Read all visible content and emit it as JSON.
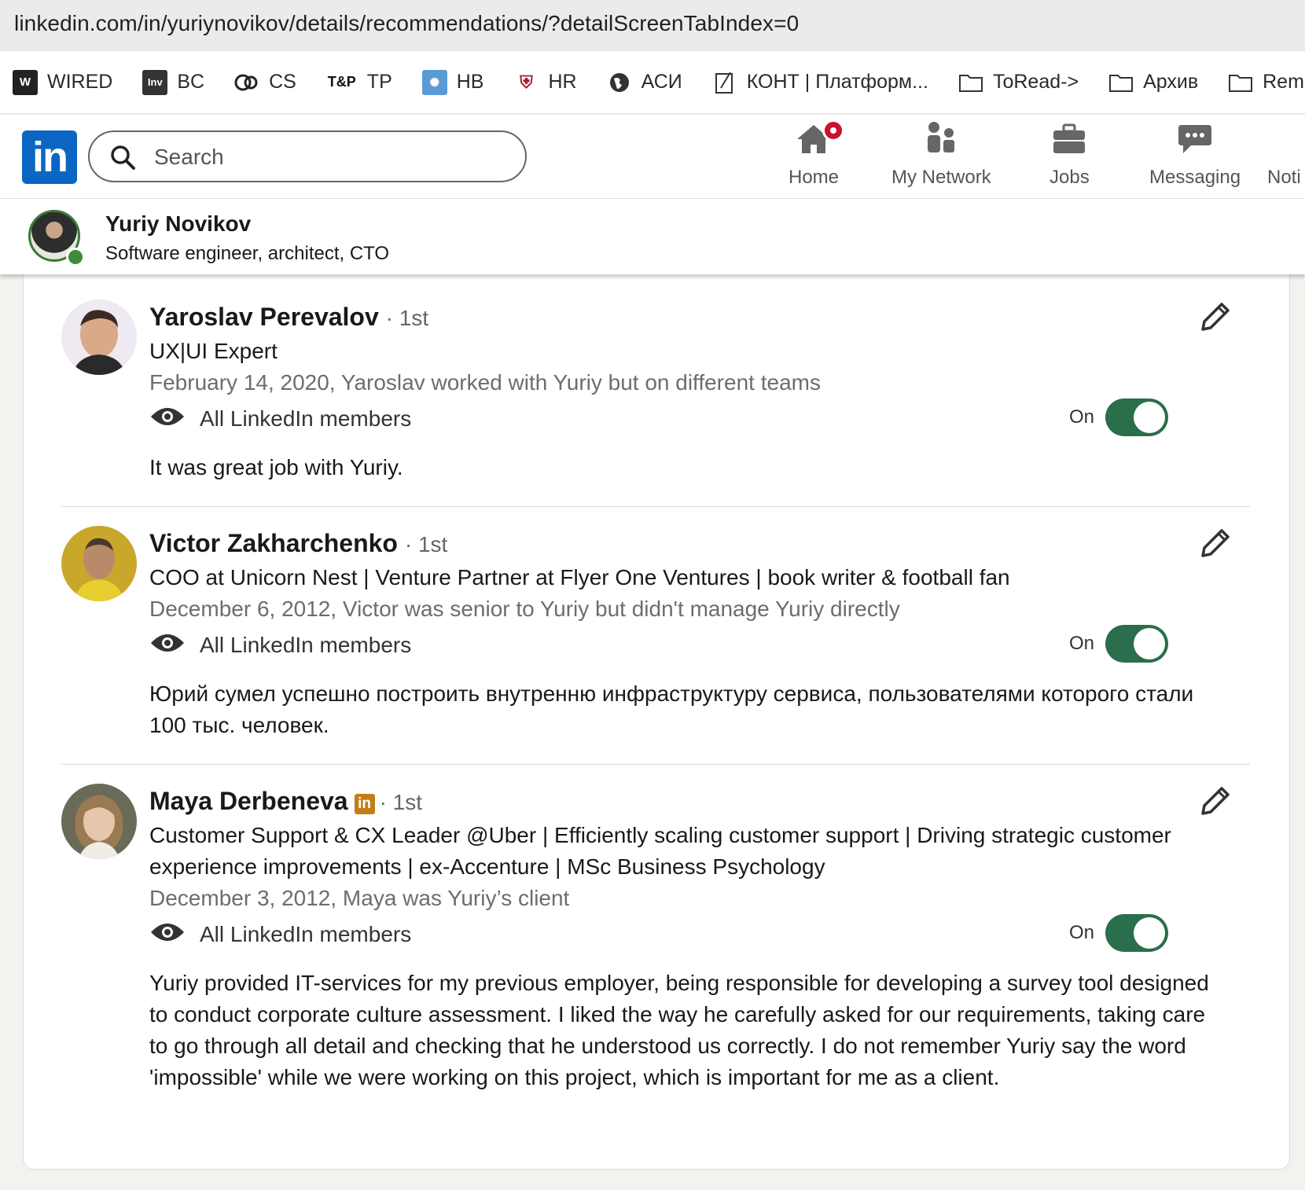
{
  "browser": {
    "url": "linkedin.com/in/yuriynovikov/details/recommendations/?detailScreenTabIndex=0",
    "bookmarks": [
      {
        "label": "WIRED",
        "icon": "wired-icon"
      },
      {
        "label": "BC",
        "icon": "invc-icon"
      },
      {
        "label": "CS",
        "icon": "cs-icon"
      },
      {
        "label": "TP",
        "icon": "tp-icon"
      },
      {
        "label": "HB",
        "icon": "hb-icon"
      },
      {
        "label": "HR",
        "icon": "hr-icon"
      },
      {
        "label": "АСИ",
        "icon": "globe-icon"
      },
      {
        "label": "КОНТ | Платформ...",
        "icon": "note-icon"
      },
      {
        "label": "ToRead->",
        "icon": "folder-icon"
      },
      {
        "label": "Архив",
        "icon": "folder-icon"
      },
      {
        "label": "Remote",
        "icon": "folder-icon"
      }
    ]
  },
  "nav": {
    "logo": "in",
    "search_placeholder": "Search",
    "items": [
      {
        "label": "Home",
        "icon": "home-icon",
        "has_badge": true
      },
      {
        "label": "My Network",
        "icon": "network-icon"
      },
      {
        "label": "Jobs",
        "icon": "briefcase-icon"
      },
      {
        "label": "Messaging",
        "icon": "messaging-icon"
      },
      {
        "label": "Noti",
        "icon": "bell-icon"
      }
    ]
  },
  "profile": {
    "name": "Yuriy Novikov",
    "title": "Software engineer, architect, CTO",
    "status": "online"
  },
  "recommendations": [
    {
      "name": "Yaroslav Perevalov",
      "degree": "· 1st",
      "headline": "UX|UI Expert",
      "meta": "February 14, 2020, Yaroslav worked with Yuriy but on different teams",
      "visibility": "All LinkedIn members",
      "toggle_label": "On",
      "toggle_on": true,
      "text": "It was great job with Yuriy."
    },
    {
      "name": "Victor Zakharchenko",
      "degree": "· 1st",
      "headline": "COO at Unicorn Nest | Venture Partner at Flyer One Ventures | book writer & football fan",
      "meta": "December 6, 2012, Victor was senior to Yuriy but didn't manage Yuriy directly",
      "visibility": "All LinkedIn members",
      "toggle_label": "On",
      "toggle_on": true,
      "text": "Юрий сумел успешно построить внутренню инфраструктуру сервиса, пользователями которого стали 100 тыс. человек."
    },
    {
      "name": "Maya Derbeneva",
      "premium_badge": "in",
      "degree": "· 1st",
      "headline": "Customer Support & CX Leader @Uber | Efficiently scaling customer support | Driving strategic customer experience improvements | ex-Accenture | MSc Business Psychology",
      "meta": "December 3, 2012, Maya was Yuriy’s client",
      "visibility": "All LinkedIn members",
      "toggle_label": "On",
      "toggle_on": true,
      "text": "Yuriy provided IT-services for my previous employer, being responsible for developing a survey tool designed to conduct corporate culture assessment. I liked the way he carefully asked for our requirements, taking care to go through all detail and checking that he understood us correctly. I do not remember Yuriy say the word 'impossible' while we were working on this project, which is important for me as a client."
    }
  ],
  "colors": {
    "linkedin_blue": "#0a66c2",
    "toggle_green": "#2a6e4b",
    "notification_red": "#cb112d",
    "premium_gold": "#c37d16"
  }
}
